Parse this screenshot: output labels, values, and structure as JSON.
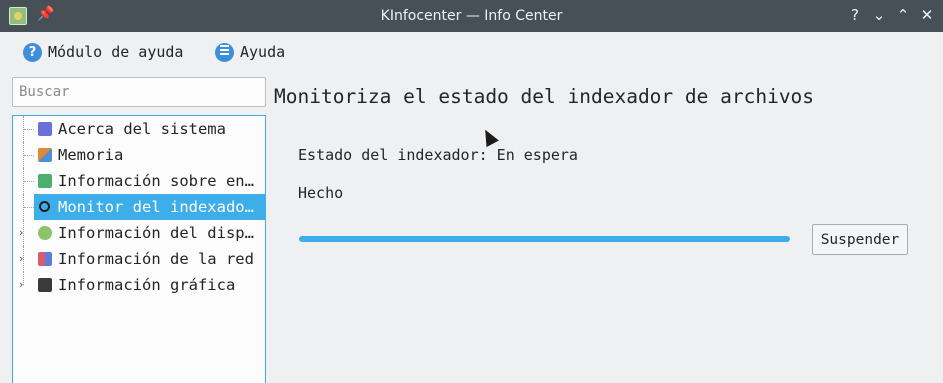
{
  "window": {
    "title": "KInfocenter — Info Center",
    "buttons": {
      "help": "?",
      "minimize": "⌄",
      "maximize": "⌃",
      "close": "✕"
    }
  },
  "toolbar": {
    "help_module": "Módulo de ayuda",
    "help_menu": "Ayuda"
  },
  "search": {
    "placeholder": "Buscar",
    "value": ""
  },
  "tree": {
    "items": [
      {
        "label": "Acerca del sistema",
        "icon": "info-bulb-icon",
        "color": "#6b6fd8",
        "expandable": false,
        "selected": false
      },
      {
        "label": "Memoria",
        "icon": "memory-chip-icon",
        "color": "#e0873a",
        "expandable": false,
        "selected": false
      },
      {
        "label": "Información sobre ene…",
        "icon": "battery-icon",
        "color": "#4caf6e",
        "expandable": false,
        "selected": false
      },
      {
        "label": "Monitor del indexador…",
        "icon": "magnifier-icon",
        "color": "#2b2b2b",
        "expandable": false,
        "selected": true
      },
      {
        "label": "Información del dispo…",
        "icon": "device-icon",
        "color": "#8dc36b",
        "expandable": true,
        "selected": false
      },
      {
        "label": "Información de la red",
        "icon": "network-icon",
        "color": "#d95b6c",
        "expandable": true,
        "selected": false
      },
      {
        "label": "Información gráfica",
        "icon": "graphics-icon",
        "color": "#3b3b3b",
        "expandable": true,
        "selected": false
      }
    ]
  },
  "main": {
    "heading": "Monitoriza el estado del indexador de archivos",
    "status": "Estado del indexador: En espera",
    "message": "Hecho",
    "progress": 1.0,
    "suspend_label": "Suspender"
  },
  "colors": {
    "accent": "#3daee9",
    "titlebar": "#475057",
    "background": "#eff0f1"
  }
}
